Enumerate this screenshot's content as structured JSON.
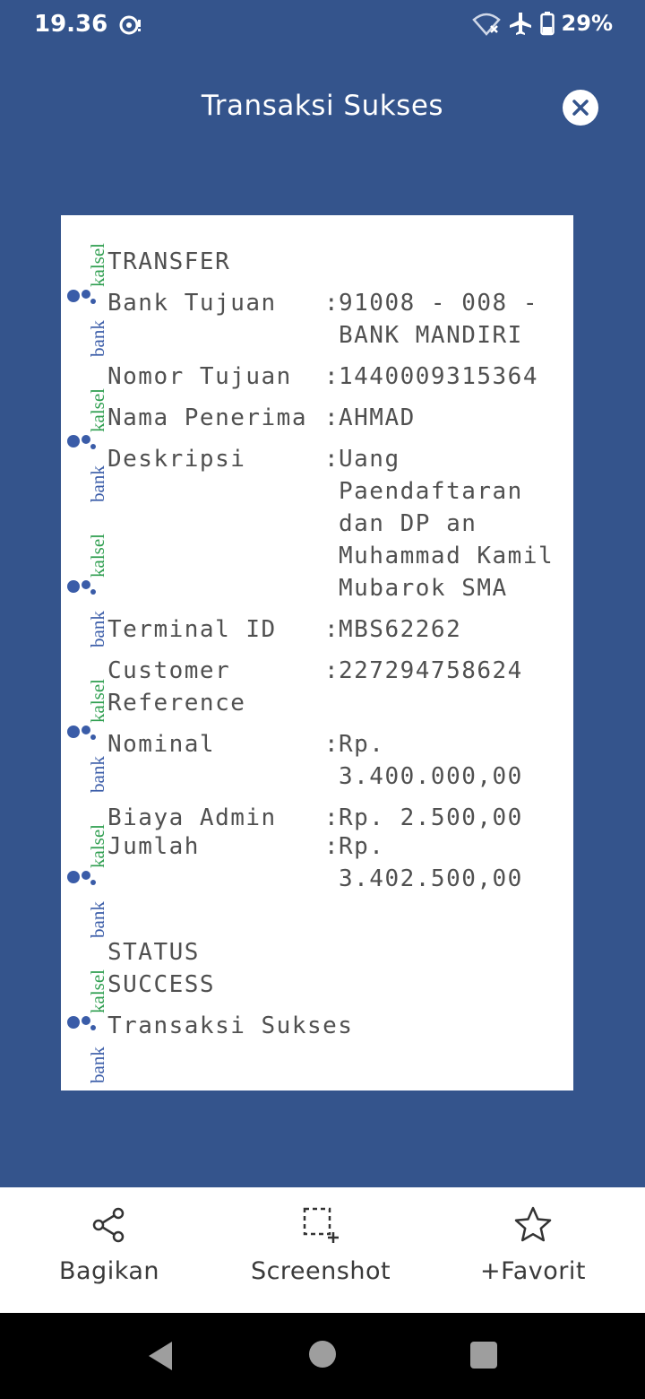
{
  "status_bar": {
    "time": "19.36",
    "battery": "29%"
  },
  "header": {
    "title": "Transaksi Sukses"
  },
  "watermark": {
    "brand_bank": "bank",
    "brand_kalsel": "kalsel"
  },
  "receipt": {
    "section_title": "TRANSFER",
    "rows": [
      {
        "label": "Bank Tujuan",
        "value_lines": [
          "91008 - 008 -",
          "BANK MANDIRI"
        ]
      },
      {
        "label": "Nomor Tujuan",
        "value_lines": [
          "1440009315364"
        ]
      },
      {
        "label": "Nama Penerima",
        "value_lines": [
          "AHMAD"
        ]
      },
      {
        "label": "Deskripsi",
        "value_lines": [
          "Uang",
          "Paendaftaran",
          "dan DP an",
          "Muhammad Kamil",
          "Mubarok SMA"
        ]
      },
      {
        "label": "Terminal ID",
        "value_lines": [
          "MBS62262"
        ]
      },
      {
        "label_lines": [
          "Customer",
          "Reference"
        ],
        "value_lines": [
          "227294758624"
        ]
      },
      {
        "label": "Nominal",
        "value_lines": [
          "Rp.",
          "3.400.000,00"
        ]
      },
      {
        "label": "Biaya Admin",
        "value_lines": [
          "Rp. 2.500,00"
        ]
      },
      {
        "label": "Jumlah",
        "value_lines": [
          "Rp.",
          "3.402.500,00"
        ]
      }
    ],
    "colon": ":",
    "status_title": "STATUS",
    "status_value": "SUCCESS",
    "status_message": "Transaksi Sukses"
  },
  "actions": {
    "share_label": "Bagikan",
    "screenshot_label": "Screenshot",
    "favorite_label": "+Favorit"
  },
  "icons": {
    "notification": "notification-icon",
    "wifi": "wifi-off-icon",
    "airplane": "airplane-icon",
    "battery": "battery-icon",
    "close": "close-icon",
    "share": "share-icon",
    "screenshot": "screenshot-icon",
    "favorite": "star-icon"
  },
  "colors": {
    "background": "#34548c",
    "watermark_green": "#2e9e4f",
    "watermark_blue": "#3a5ca8"
  }
}
